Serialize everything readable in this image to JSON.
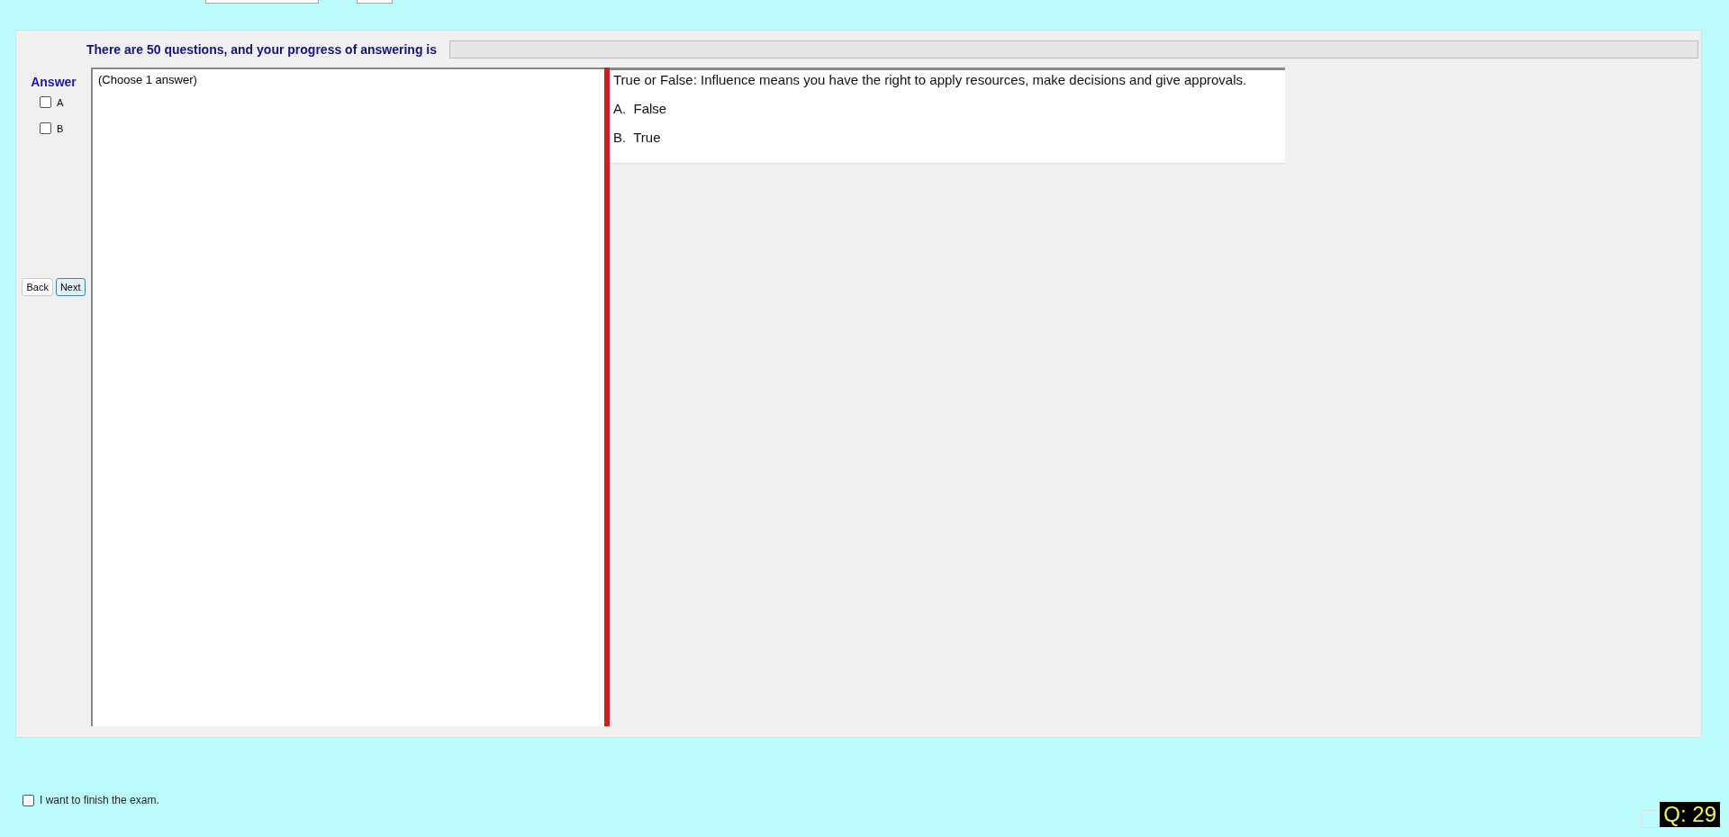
{
  "progress": {
    "text": "There are 50 questions, and your progress of answering is",
    "level": 0
  },
  "answer_panel": {
    "title": "Answer",
    "options": [
      {
        "label": "A",
        "checked": false
      },
      {
        "label": "B",
        "checked": false
      }
    ]
  },
  "navigation": [
    {
      "label": "Back",
      "selected": false
    },
    {
      "label": "Next",
      "selected": true
    }
  ],
  "instruction": "(Choose 1 answer)",
  "question": {
    "text": "True or False: Influence means you have the right to apply resources, make decisions and give approvals.",
    "choices": [
      {
        "letter": "A.",
        "text": "False"
      },
      {
        "letter": "B.",
        "text": "True"
      }
    ]
  },
  "finish": {
    "label": "I want to finish the exam.",
    "checked": false
  },
  "question_counter": "Q: 29"
}
